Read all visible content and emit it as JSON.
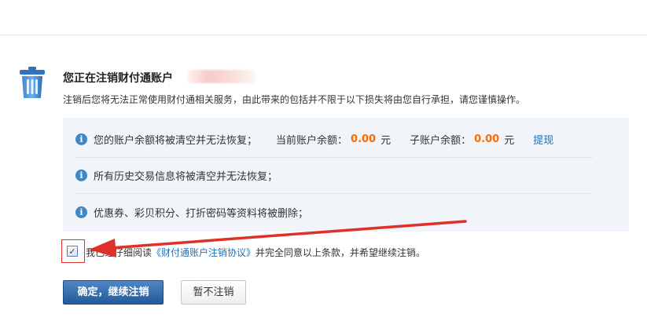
{
  "header": {
    "title": "您正在注销财付通账户",
    "subtitle": "注销后您将无法正常使用财付通相关服务，由此带来的包括并不限于以下损失将由您自行承担，请您谨慎操作。",
    "icon": "trash-icon"
  },
  "info": {
    "rows": [
      {
        "text": "您的账户余额将被清空并无法恢复；"
      },
      {
        "text": "所有历史交易信息将被清空并无法恢复；"
      },
      {
        "text": "优惠券、彩贝积分、打折密码等资料将被删除；"
      }
    ],
    "current_balance_label": "当前账户余额：",
    "current_balance_value": "0.00",
    "current_balance_unit": "元",
    "sub_balance_label": "子账户余额：",
    "sub_balance_value": "0.00",
    "sub_balance_unit": "元",
    "withdraw_link": "提现",
    "icon_glyph": "i"
  },
  "agreement": {
    "checked": true,
    "check_glyph": "✓",
    "prefix": "我已经仔细阅读",
    "link_text": "《财付通账户注销协议》",
    "suffix": "并完全同意以上条款，并希望继续注销。"
  },
  "buttons": {
    "confirm": "确定，继续注销",
    "cancel": "暂不注销"
  },
  "colors": {
    "amount": "#ff6a00",
    "link": "#1f6fb5",
    "primary_button": "#2f6aa8",
    "annotation_red": "#e0302a",
    "info_bg": "#f1f4f8"
  }
}
